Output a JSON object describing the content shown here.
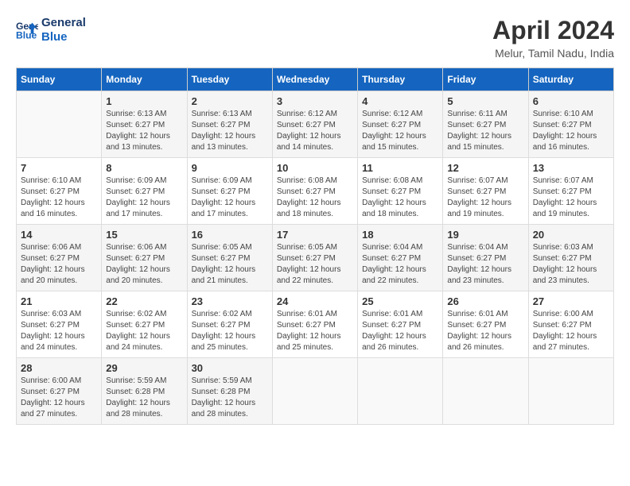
{
  "logo": {
    "line1": "General",
    "line2": "Blue"
  },
  "title": "April 2024",
  "location": "Melur, Tamil Nadu, India",
  "days_header": [
    "Sunday",
    "Monday",
    "Tuesday",
    "Wednesday",
    "Thursday",
    "Friday",
    "Saturday"
  ],
  "weeks": [
    [
      {
        "day": "",
        "info": ""
      },
      {
        "day": "1",
        "info": "Sunrise: 6:13 AM\nSunset: 6:27 PM\nDaylight: 12 hours\nand 13 minutes."
      },
      {
        "day": "2",
        "info": "Sunrise: 6:13 AM\nSunset: 6:27 PM\nDaylight: 12 hours\nand 13 minutes."
      },
      {
        "day": "3",
        "info": "Sunrise: 6:12 AM\nSunset: 6:27 PM\nDaylight: 12 hours\nand 14 minutes."
      },
      {
        "day": "4",
        "info": "Sunrise: 6:12 AM\nSunset: 6:27 PM\nDaylight: 12 hours\nand 15 minutes."
      },
      {
        "day": "5",
        "info": "Sunrise: 6:11 AM\nSunset: 6:27 PM\nDaylight: 12 hours\nand 15 minutes."
      },
      {
        "day": "6",
        "info": "Sunrise: 6:10 AM\nSunset: 6:27 PM\nDaylight: 12 hours\nand 16 minutes."
      }
    ],
    [
      {
        "day": "7",
        "info": "Sunrise: 6:10 AM\nSunset: 6:27 PM\nDaylight: 12 hours\nand 16 minutes."
      },
      {
        "day": "8",
        "info": "Sunrise: 6:09 AM\nSunset: 6:27 PM\nDaylight: 12 hours\nand 17 minutes."
      },
      {
        "day": "9",
        "info": "Sunrise: 6:09 AM\nSunset: 6:27 PM\nDaylight: 12 hours\nand 17 minutes."
      },
      {
        "day": "10",
        "info": "Sunrise: 6:08 AM\nSunset: 6:27 PM\nDaylight: 12 hours\nand 18 minutes."
      },
      {
        "day": "11",
        "info": "Sunrise: 6:08 AM\nSunset: 6:27 PM\nDaylight: 12 hours\nand 18 minutes."
      },
      {
        "day": "12",
        "info": "Sunrise: 6:07 AM\nSunset: 6:27 PM\nDaylight: 12 hours\nand 19 minutes."
      },
      {
        "day": "13",
        "info": "Sunrise: 6:07 AM\nSunset: 6:27 PM\nDaylight: 12 hours\nand 19 minutes."
      }
    ],
    [
      {
        "day": "14",
        "info": "Sunrise: 6:06 AM\nSunset: 6:27 PM\nDaylight: 12 hours\nand 20 minutes."
      },
      {
        "day": "15",
        "info": "Sunrise: 6:06 AM\nSunset: 6:27 PM\nDaylight: 12 hours\nand 20 minutes."
      },
      {
        "day": "16",
        "info": "Sunrise: 6:05 AM\nSunset: 6:27 PM\nDaylight: 12 hours\nand 21 minutes."
      },
      {
        "day": "17",
        "info": "Sunrise: 6:05 AM\nSunset: 6:27 PM\nDaylight: 12 hours\nand 22 minutes."
      },
      {
        "day": "18",
        "info": "Sunrise: 6:04 AM\nSunset: 6:27 PM\nDaylight: 12 hours\nand 22 minutes."
      },
      {
        "day": "19",
        "info": "Sunrise: 6:04 AM\nSunset: 6:27 PM\nDaylight: 12 hours\nand 23 minutes."
      },
      {
        "day": "20",
        "info": "Sunrise: 6:03 AM\nSunset: 6:27 PM\nDaylight: 12 hours\nand 23 minutes."
      }
    ],
    [
      {
        "day": "21",
        "info": "Sunrise: 6:03 AM\nSunset: 6:27 PM\nDaylight: 12 hours\nand 24 minutes."
      },
      {
        "day": "22",
        "info": "Sunrise: 6:02 AM\nSunset: 6:27 PM\nDaylight: 12 hours\nand 24 minutes."
      },
      {
        "day": "23",
        "info": "Sunrise: 6:02 AM\nSunset: 6:27 PM\nDaylight: 12 hours\nand 25 minutes."
      },
      {
        "day": "24",
        "info": "Sunrise: 6:01 AM\nSunset: 6:27 PM\nDaylight: 12 hours\nand 25 minutes."
      },
      {
        "day": "25",
        "info": "Sunrise: 6:01 AM\nSunset: 6:27 PM\nDaylight: 12 hours\nand 26 minutes."
      },
      {
        "day": "26",
        "info": "Sunrise: 6:01 AM\nSunset: 6:27 PM\nDaylight: 12 hours\nand 26 minutes."
      },
      {
        "day": "27",
        "info": "Sunrise: 6:00 AM\nSunset: 6:27 PM\nDaylight: 12 hours\nand 27 minutes."
      }
    ],
    [
      {
        "day": "28",
        "info": "Sunrise: 6:00 AM\nSunset: 6:27 PM\nDaylight: 12 hours\nand 27 minutes."
      },
      {
        "day": "29",
        "info": "Sunrise: 5:59 AM\nSunset: 6:28 PM\nDaylight: 12 hours\nand 28 minutes."
      },
      {
        "day": "30",
        "info": "Sunrise: 5:59 AM\nSunset: 6:28 PM\nDaylight: 12 hours\nand 28 minutes."
      },
      {
        "day": "",
        "info": ""
      },
      {
        "day": "",
        "info": ""
      },
      {
        "day": "",
        "info": ""
      },
      {
        "day": "",
        "info": ""
      }
    ]
  ]
}
